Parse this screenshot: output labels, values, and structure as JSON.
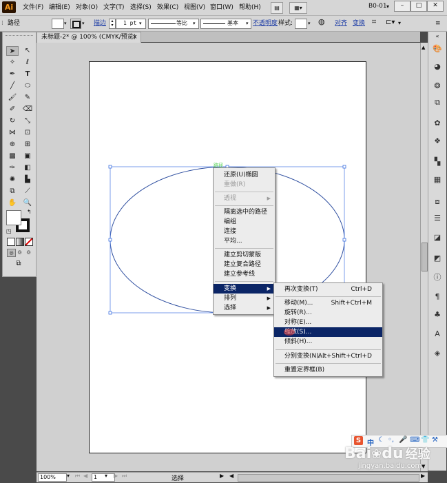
{
  "app": {
    "logo": "Ai",
    "workspace": "B0-01",
    "win_min": "–",
    "win_max": "□",
    "win_close": "✕"
  },
  "menubar": {
    "items": [
      "文件(F)",
      "编辑(E)",
      "对象(O)",
      "文字(T)",
      "选择(S)",
      "效果(C)",
      "视图(V)",
      "窗口(W)",
      "帮助(H)"
    ]
  },
  "controlbar": {
    "path_label": "路径",
    "stroke_link": "描边",
    "stroke_weight": "1 pt",
    "profile_label": "等比",
    "brush_label": "基本",
    "opacity_link": "不透明度",
    "style_label": "样式:",
    "align_link": "对齐",
    "transform_link": "变换"
  },
  "document": {
    "tab_title": "未标题-2* @ 100% (CMYK/预览)",
    "tab_close": "×"
  },
  "anchor_label": "路径",
  "context_menu": {
    "items": [
      {
        "label": "还原(U)椭圆",
        "disabled": false
      },
      {
        "label": "重做(R)",
        "disabled": true
      },
      {
        "label": "透视",
        "disabled": true,
        "submenu": true
      },
      {
        "label": "隔离选中的路径",
        "disabled": false
      },
      {
        "label": "编组",
        "disabled": false
      },
      {
        "label": "连接",
        "disabled": false
      },
      {
        "label": "平均...",
        "disabled": false
      },
      {
        "label": "建立剪切蒙版",
        "disabled": false
      },
      {
        "label": "建立复合路径",
        "disabled": false
      },
      {
        "label": "建立参考线",
        "disabled": false
      },
      {
        "label": "变换",
        "highlighted": true,
        "submenu": true
      },
      {
        "label": "排列",
        "submenu": true
      },
      {
        "label": "选择",
        "submenu": true
      }
    ]
  },
  "submenu": {
    "items": [
      {
        "label": "再次变换(T)",
        "shortcut": "Ctrl+D"
      },
      {
        "label": "移动(M)...",
        "shortcut": "Shift+Ctrl+M"
      },
      {
        "label": "旋转(R)...",
        "shortcut": ""
      },
      {
        "label": "对称(E)...",
        "shortcut": ""
      },
      {
        "label": "缩放(S)...",
        "shortcut": "",
        "highlighted": true
      },
      {
        "label": "倾斜(H)...",
        "shortcut": ""
      },
      {
        "label": "分别变换(N)...",
        "shortcut": "Alt+Shift+Ctrl+D"
      },
      {
        "label": "重置定界框(B)",
        "shortcut": ""
      }
    ]
  },
  "statusbar": {
    "zoom": "100%",
    "page": "1",
    "status_text": "选择"
  },
  "ime_bar": {
    "brand": "S",
    "lang": "中"
  },
  "watermark": {
    "brand": "Bai",
    "paw": "du",
    "sub_brand": "经验",
    "url": "jingyan.baidu.com"
  },
  "colors": {
    "highlight": "#0b2566",
    "canvas": "#d0d0d0",
    "selection": "#3b6fe0",
    "logo_bg": "#2b1300",
    "logo_fg": "#f79a1e"
  }
}
